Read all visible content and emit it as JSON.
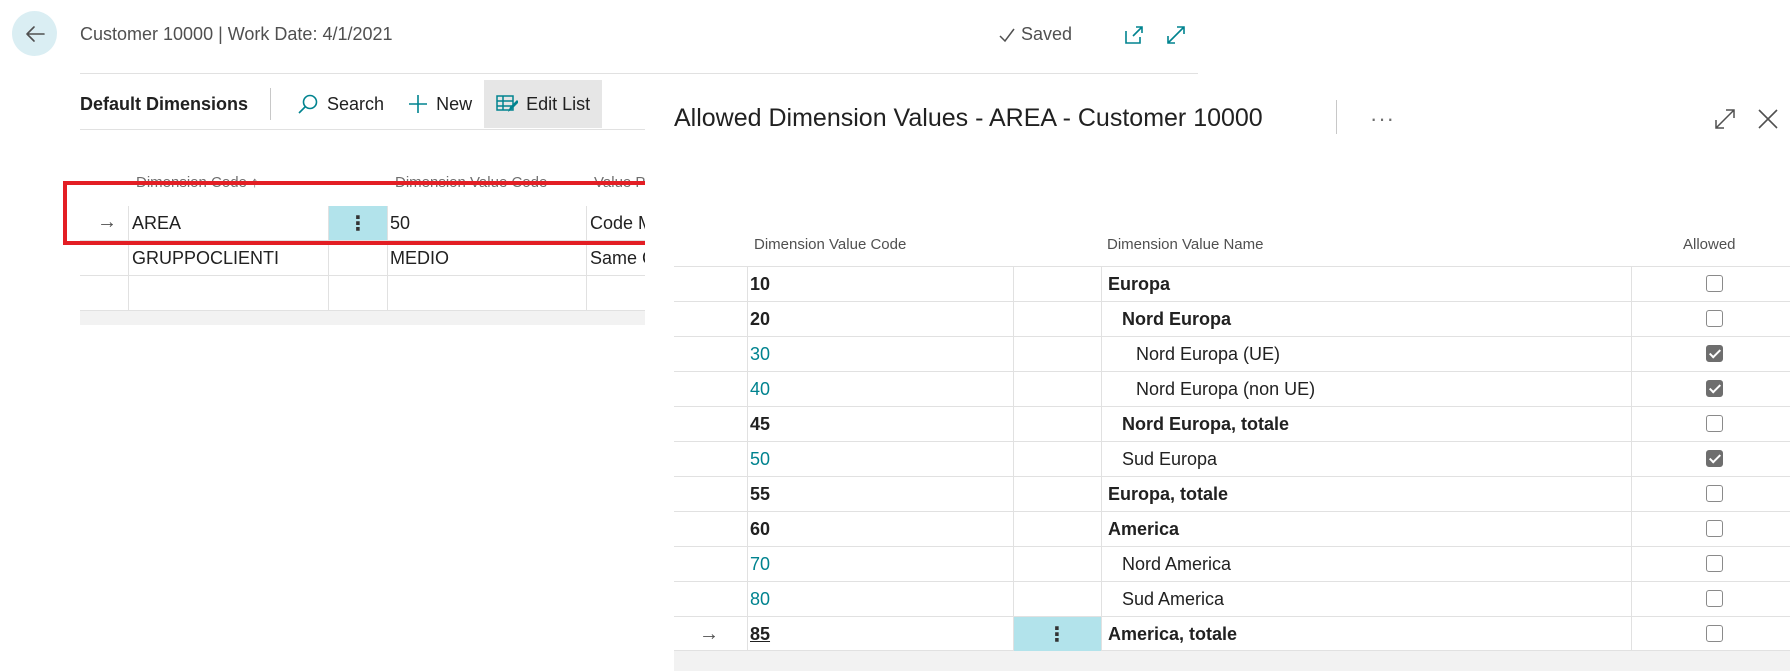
{
  "page": {
    "caption": "Customer 10000 | Work Date: 4/1/2021",
    "saved_label": "Saved"
  },
  "actions": {
    "title": "Default Dimensions",
    "search": "Search",
    "new": "New",
    "edit_list": "Edit List"
  },
  "bg_grid": {
    "headers": [
      "Dimension Code ↑",
      "Dimension Value Code",
      "Value P"
    ],
    "rows": [
      {
        "code": "AREA",
        "value": "50",
        "posting": "Code M",
        "current": true
      },
      {
        "code": "GRUPPOCLIENTI",
        "value": "MEDIO",
        "posting": "Same C",
        "current": false
      }
    ]
  },
  "pane": {
    "title": "Allowed Dimension Values - AREA - Customer 10000",
    "more": "···",
    "headers": {
      "code": "Dimension Value Code",
      "name": "Dimension Value Name",
      "allowed": "Allowed"
    },
    "rows": [
      {
        "code": "10",
        "name": "Europa",
        "allowed": false
      },
      {
        "code": "20",
        "name": "Nord Europa",
        "allowed": false
      },
      {
        "code": "30",
        "name": "Nord Europa (UE)",
        "allowed": true
      },
      {
        "code": "40",
        "name": "Nord Europa (non UE)",
        "allowed": true
      },
      {
        "code": "45",
        "name": "Nord Europa, totale",
        "allowed": false
      },
      {
        "code": "50",
        "name": "Sud Europa",
        "allowed": true
      },
      {
        "code": "55",
        "name": "Europa, totale",
        "allowed": false
      },
      {
        "code": "60",
        "name": "America",
        "allowed": false
      },
      {
        "code": "70",
        "name": "Nord America",
        "allowed": false
      },
      {
        "code": "80",
        "name": "Sud America",
        "allowed": false
      },
      {
        "code": "85",
        "name": "America, totale",
        "allowed": false
      }
    ]
  },
  "colors": {
    "accent": "#00838f",
    "selection": "#b2e3eb",
    "highlight_box": "#e31e24"
  }
}
